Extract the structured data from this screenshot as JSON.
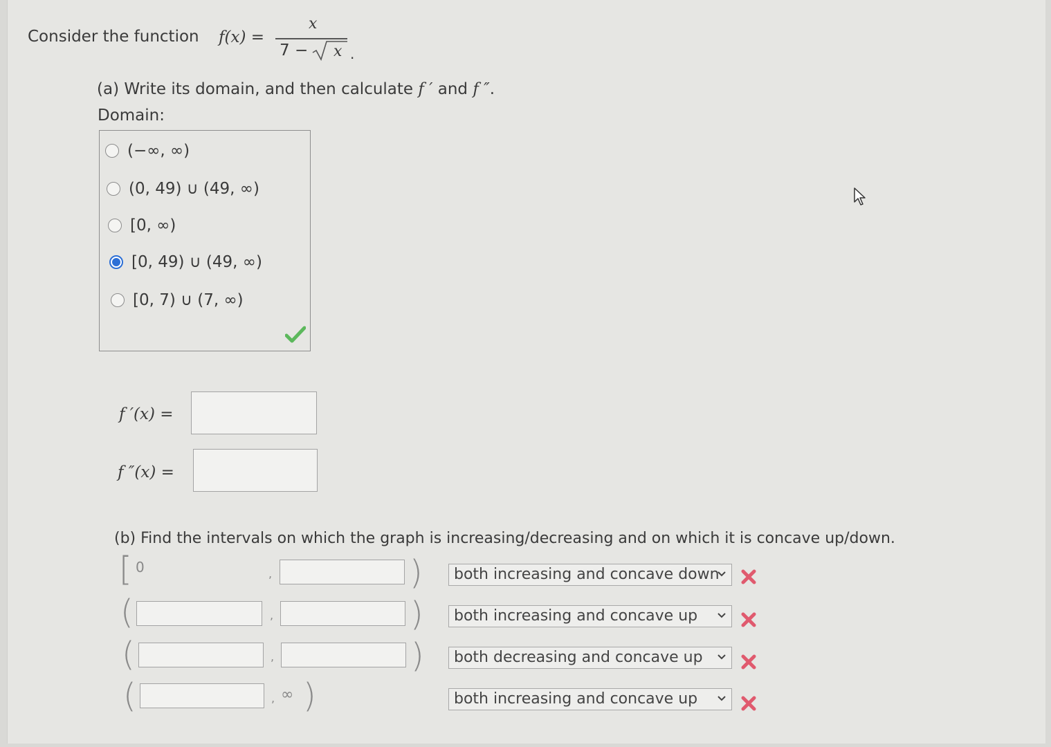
{
  "problem": {
    "intro": "Consider the function",
    "fx": "f(x) =",
    "numerator": "x",
    "denominator_const": "7 −",
    "denominator_var": "x",
    "period": "."
  },
  "part_a": {
    "prompt_start": "(a) Write its domain, and then calculate ",
    "f_prime": "f ′",
    "and": " and ",
    "f_double": "f ″",
    "prompt_end": ".",
    "domain_label": "Domain:",
    "options": [
      {
        "label": "(−∞, ∞)",
        "selected": false
      },
      {
        "label": "(0, 49) ∪ (49, ∞)",
        "selected": false
      },
      {
        "label": "[0, ∞)",
        "selected": false
      },
      {
        "label": "[0, 49) ∪ (49, ∞)",
        "selected": true
      },
      {
        "label": "[0, 7) ∪ (7, ∞)",
        "selected": false
      }
    ],
    "domain_status": "correct",
    "fprime_label": "f ′(x)  =",
    "fdouble_label": "f ″(x)  =",
    "fprime_value": "",
    "fdouble_value": ""
  },
  "part_b": {
    "prompt": "(b) Find the intervals on which the graph is increasing/decreasing and on which it is concave up/down.",
    "rows": [
      {
        "left_bracket": "[",
        "start": "0",
        "end": "",
        "right_bracket": ")",
        "selection": "both increasing and concave down",
        "status": "incorrect"
      },
      {
        "left_bracket": "(",
        "start": "",
        "end": "",
        "right_bracket": ")",
        "selection": "both increasing and concave up",
        "status": "incorrect"
      },
      {
        "left_bracket": "(",
        "start": "",
        "end": "",
        "right_bracket": ")",
        "selection": "both decreasing and concave up",
        "status": "incorrect"
      },
      {
        "left_bracket": "(",
        "start": "",
        "end": "∞",
        "right_bracket": ")",
        "selection": "both increasing and concave up",
        "status": "incorrect"
      }
    ],
    "comma": ","
  },
  "colors": {
    "check": "#5cb85c",
    "x_mark": "#e05a6e",
    "radio_selected": "#2c6fd6"
  }
}
